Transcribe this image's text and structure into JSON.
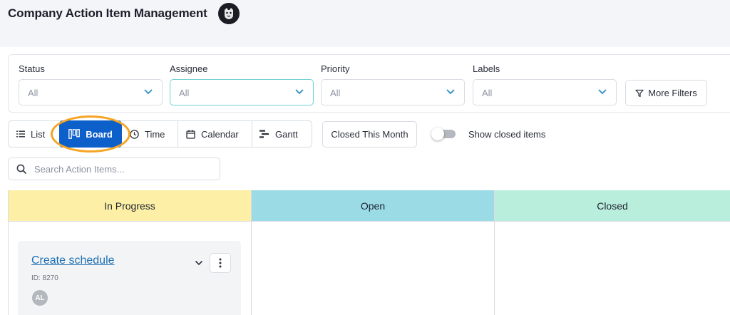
{
  "header": {
    "title": "Company Action Item Management"
  },
  "filters": [
    {
      "label": "Status",
      "value": "All"
    },
    {
      "label": "Assignee",
      "value": "All"
    },
    {
      "label": "Priority",
      "value": "All"
    },
    {
      "label": "Labels",
      "value": "All"
    }
  ],
  "more_filters_label": "More Filters",
  "views": [
    {
      "label": "List",
      "icon": "list-icon"
    },
    {
      "label": "Board",
      "icon": "board-icon",
      "selected": true
    },
    {
      "label": "Time",
      "icon": "clock-icon"
    },
    {
      "label": "Calendar",
      "icon": "calendar-icon"
    },
    {
      "label": "Gantt",
      "icon": "gantt-icon"
    }
  ],
  "closed_this_month_label": "Closed This Month",
  "show_closed": {
    "label": "Show closed items",
    "on": false
  },
  "search": {
    "placeholder": "Search Action Items..."
  },
  "columns": [
    {
      "title": "In Progress",
      "color": "#fdf0a6"
    },
    {
      "title": "Open",
      "color": "#9adbe6"
    },
    {
      "title": "Closed",
      "color": "#b9eedd"
    }
  ],
  "card": {
    "title": "Create schedule",
    "id": "ID: 8270",
    "assignee_initials": "AL"
  },
  "colors": {
    "accent": "#0d5fc9",
    "highlight": "#f5a524",
    "link": "#1d6fb5"
  }
}
